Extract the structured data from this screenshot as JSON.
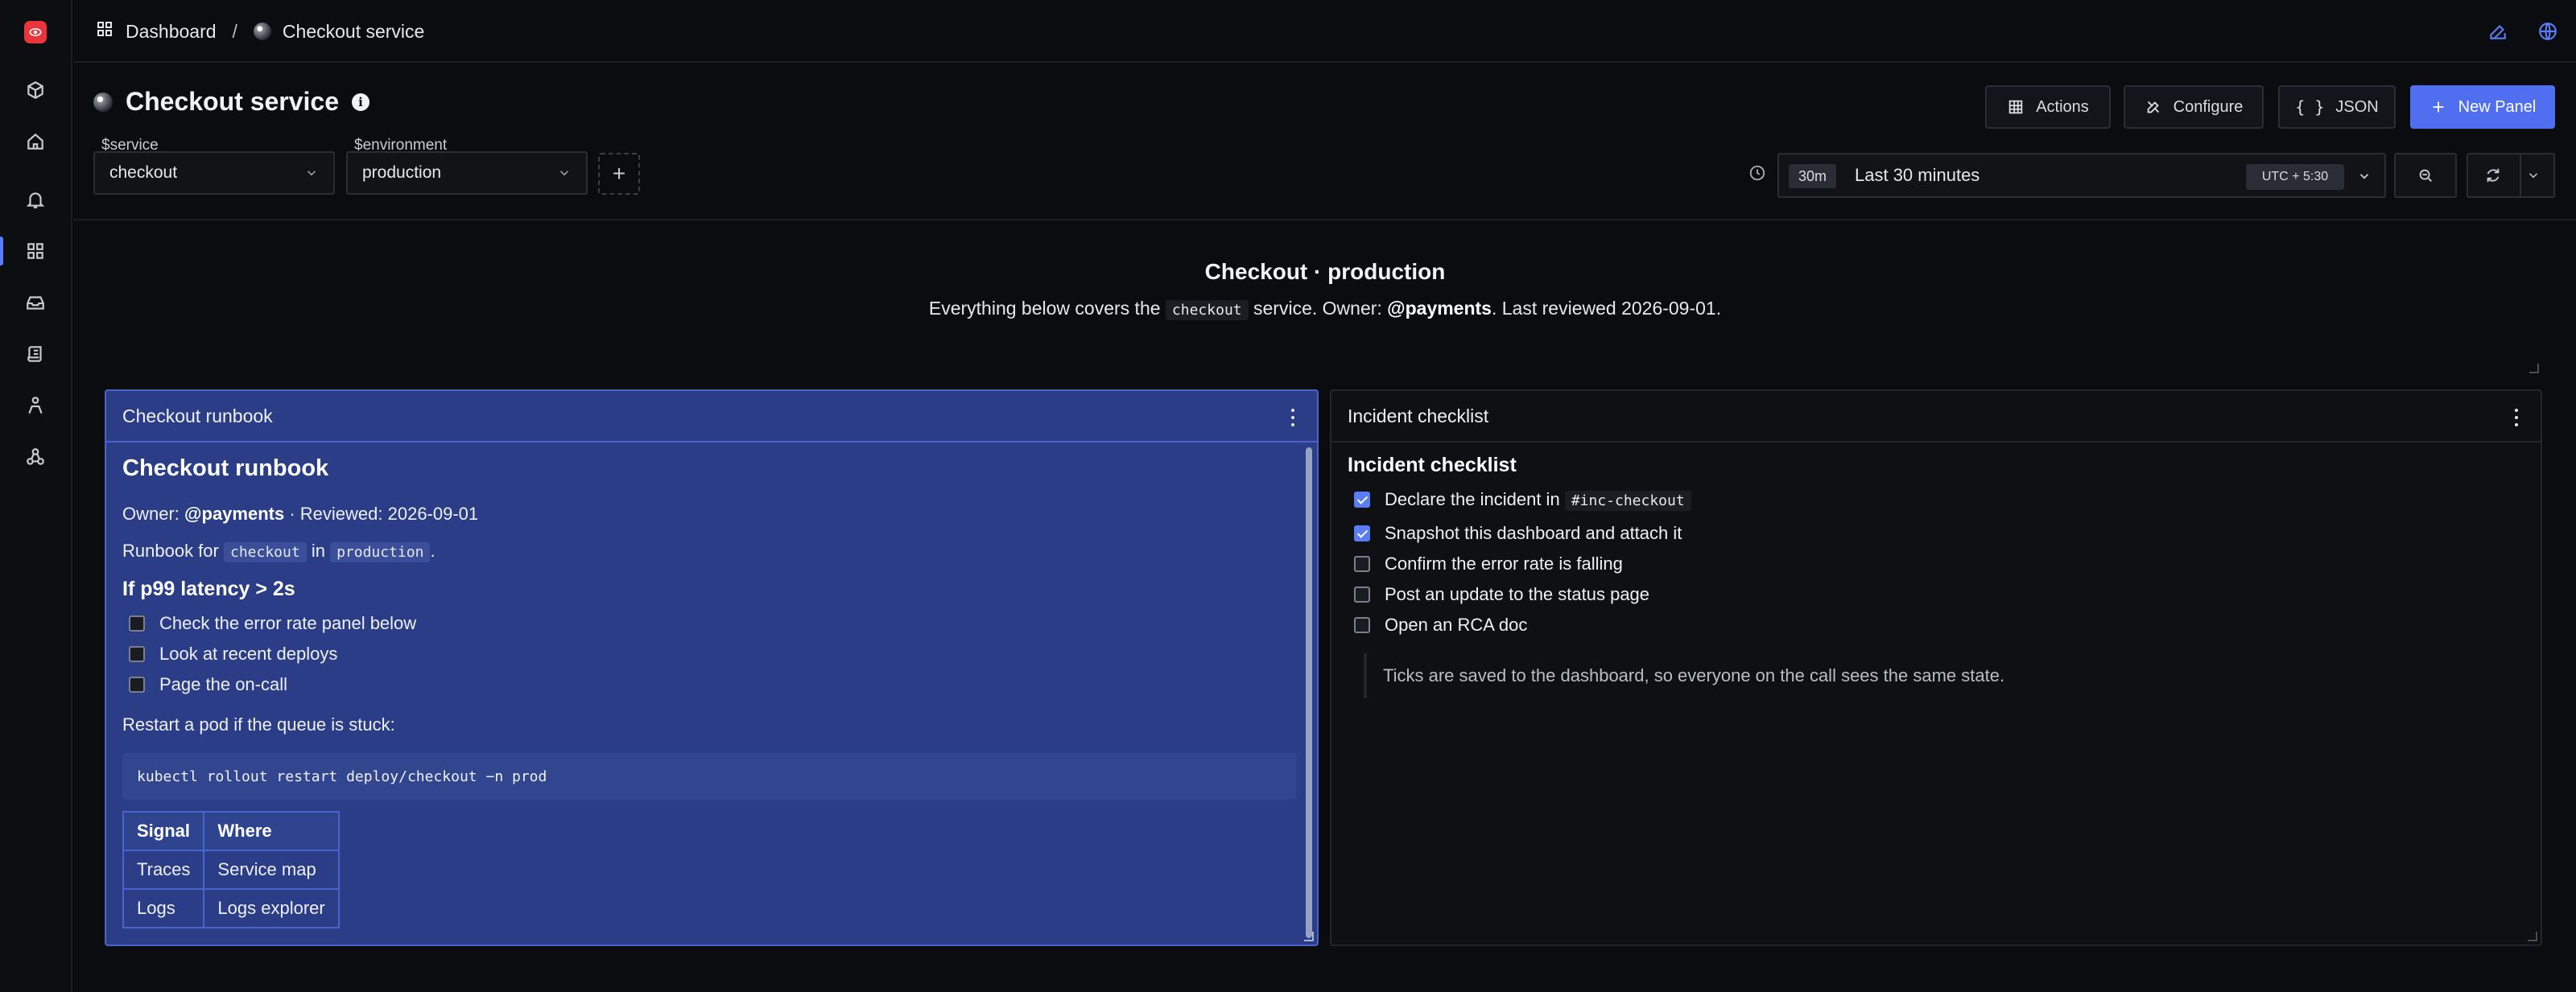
{
  "breadcrumb": {
    "root": "Dashboard",
    "separator": "/",
    "current": "Checkout service"
  },
  "page": {
    "title": "Checkout service"
  },
  "header_buttons": {
    "actions": "Actions",
    "configure": "Configure",
    "json": "JSON",
    "new_panel": "New Panel"
  },
  "variables": [
    {
      "label": "$service",
      "value": "checkout"
    },
    {
      "label": "$environment",
      "value": "production"
    }
  ],
  "add_variable": "+",
  "time": {
    "chip": "30m",
    "range": "Last 30 minutes",
    "timezone": "UTC + 5:30"
  },
  "text_panel": {
    "title": "Checkout · production",
    "sub_before": "Everything below covers the",
    "sub_code": "checkout",
    "sub_mid": "service. Owner:",
    "sub_owner": "@payments",
    "sub_after": ". Last reviewed 2026-09-01."
  },
  "runbook_panel": {
    "header": "Checkout runbook",
    "heading": "Checkout runbook",
    "owner_label": "Owner:",
    "owner": "@payments",
    "reviewed": "· Reviewed: 2026-09-01",
    "runbook_for": "Runbook for",
    "service_code": "checkout",
    "in": "in",
    "env_code": "production",
    "period": ".",
    "section": "If p99 latency > 2s",
    "checklist": [
      {
        "label": "Check the error rate panel below",
        "checked": false
      },
      {
        "label": "Look at recent deploys",
        "checked": false
      },
      {
        "label": "Page the on-call",
        "checked": false
      }
    ],
    "restart_text": "Restart a pod if the queue is stuck:",
    "command": "kubectl rollout restart deploy/checkout −n prod",
    "table": {
      "headers": [
        "Signal",
        "Where"
      ],
      "rows": [
        [
          "Traces",
          "Service map"
        ],
        [
          "Logs",
          "Logs explorer"
        ]
      ]
    }
  },
  "checklist_panel": {
    "header": "Incident checklist",
    "heading": "Incident checklist",
    "item0_text": "Declare the incident in",
    "item0_code": "#inc-checkout",
    "items": [
      {
        "label": "Snapshot this dashboard and attach it",
        "checked": true
      },
      {
        "label": "Confirm the error rate is falling",
        "checked": false
      },
      {
        "label": "Post an update to the status page",
        "checked": false
      },
      {
        "label": "Open an RCA doc",
        "checked": false
      }
    ],
    "note": "Ticks are saved to the dashboard, so everyone on the call sees the same state."
  },
  "colors": {
    "accent": "#4f6ff0",
    "logo": "#e8363c",
    "runbook_bg": "#2a3d86",
    "background": "#0b0c0f"
  },
  "icons": {
    "sidebar": [
      "logo-icon",
      "cube-icon",
      "home-icon",
      "bell-icon",
      "grid-icon",
      "inbox-icon",
      "scroll-icon",
      "person-icon",
      "network-icon"
    ],
    "top_right": [
      "edit-icon",
      "globe-icon"
    ]
  }
}
